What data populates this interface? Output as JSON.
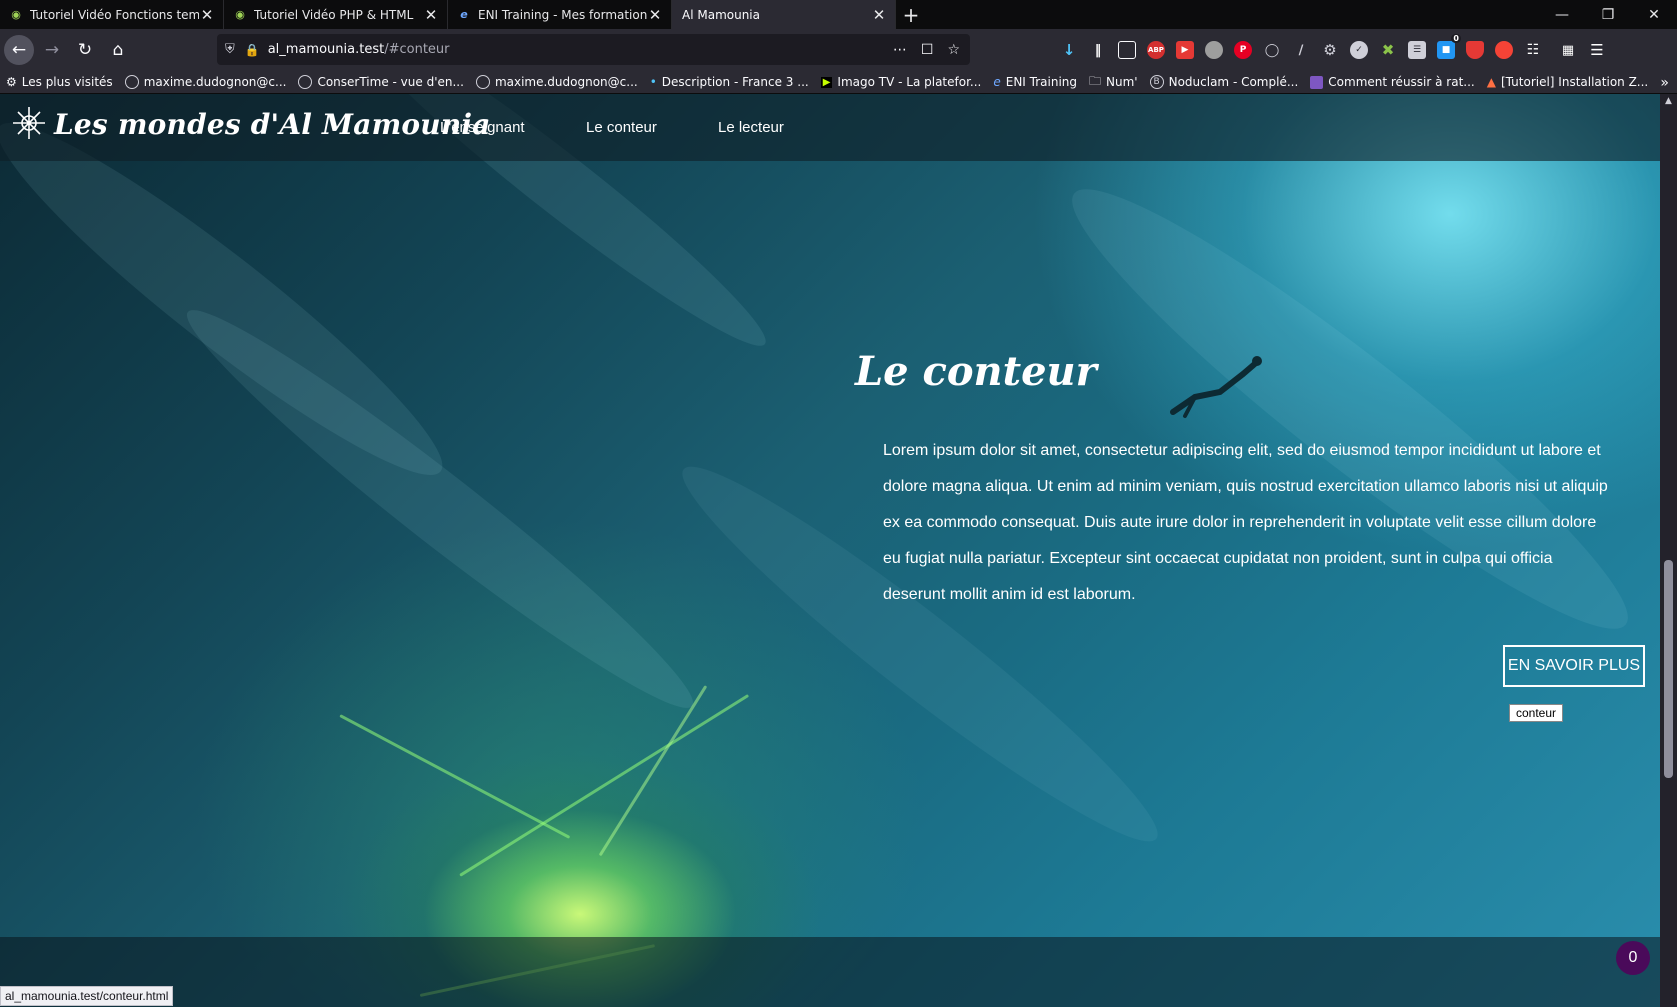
{
  "browser": {
    "tabs": [
      {
        "title": "Tutoriel Vidéo Fonctions temporelles",
        "active": false
      },
      {
        "title": "Tutoriel Vidéo PHP & HTML",
        "active": false
      },
      {
        "title": "ENI Training - Mes formations",
        "active": false
      },
      {
        "title": "Al Mamounia",
        "active": true
      }
    ],
    "url_host": "al_mamounia.test",
    "url_path": "/#conteur",
    "bookmarks": [
      "Les plus visités",
      "maxime.dudognon@c...",
      "ConserTime - vue d'en...",
      "maxime.dudognon@c...",
      "Description - France 3 ...",
      "Imago TV - La platefor...",
      "ENI Training",
      "Num'",
      "Noduclam - Complé...",
      "Comment réussir à rat...",
      "[Tutoriel] Installation Z..."
    ],
    "extension_badge": "0",
    "status_url": "al_mamounia.test/conteur.html"
  },
  "site": {
    "title": "Les mondes d'Al Mamounia",
    "menu": [
      "L'enseignant",
      "Le conteur",
      "Le lecteur"
    ],
    "section_title": "Le conteur",
    "section_text": "Lorem ipsum dolor sit amet, consectetur adipiscing elit, sed do eiusmod tempor incididunt ut labore et dolore magna aliqua. Ut enim ad minim veniam, quis nostrud exercitation ullamco laboris nisi ut aliquip ex ea commodo consequat. Duis aute irure dolor in reprehenderit in voluptate velit esse cillum dolore eu fugiat nulla pariatur. Excepteur sint occaecat cupidatat non proident, sunt in culpa qui officia deserunt mollit anim id est laborum.",
    "cta_label": "EN SAVOIR PLUS",
    "tooltip": "conteur",
    "counter": "0"
  },
  "colors": {
    "chrome_dark": "#0c0c0d",
    "chrome": "#2b2a33",
    "badge": "#4a0a5a",
    "ocean": "#1a6b82",
    "glow": "#b8ff7a"
  }
}
